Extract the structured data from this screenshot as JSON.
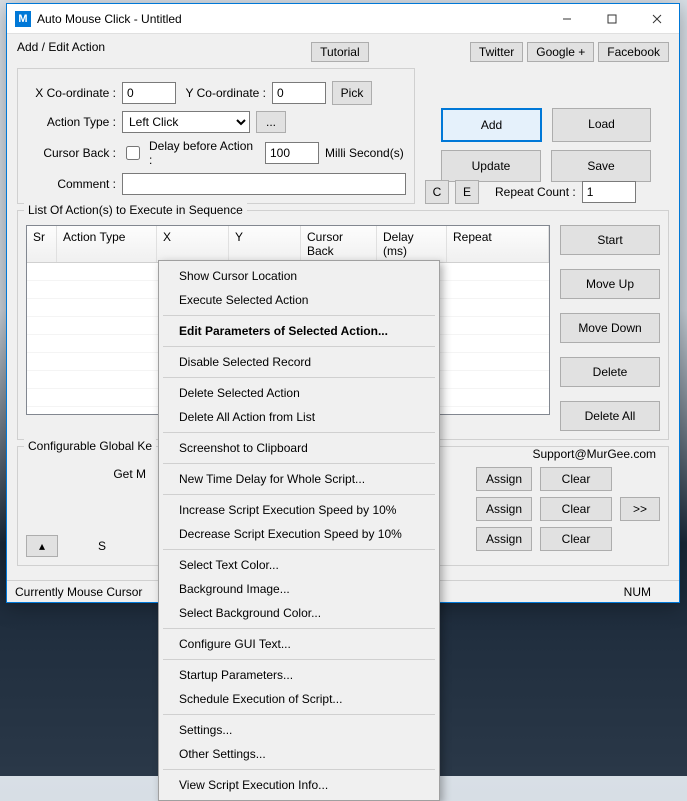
{
  "titlebar": {
    "app_icon_letter": "M",
    "title": "Auto Mouse Click - Untitled"
  },
  "top_buttons": {
    "tutorial": "Tutorial",
    "twitter": "Twitter",
    "google": "Google +",
    "facebook": "Facebook"
  },
  "add_edit": {
    "legend": "Add / Edit Action",
    "x_label": "X Co-ordinate :",
    "x_value": "0",
    "y_label": "Y Co-ordinate :",
    "y_value": "0",
    "pick": "Pick",
    "action_type_label": "Action Type :",
    "action_type_value": "Left Click",
    "dots": "...",
    "cursor_back_label": "Cursor Back :",
    "delay_label": "Delay before Action :",
    "delay_value": "100",
    "delay_units": "Milli Second(s)",
    "comment_label": "Comment :",
    "comment_value": "",
    "c_btn": "C",
    "e_btn": "E"
  },
  "main_buttons": {
    "add": "Add",
    "load": "Load",
    "update": "Update",
    "save": "Save"
  },
  "repeat": {
    "label": "Repeat Count :",
    "value": "1"
  },
  "list": {
    "legend": "List Of Action(s) to Execute in Sequence",
    "headers": {
      "sr": "Sr",
      "action_type": "Action Type",
      "x": "X",
      "y": "Y",
      "cursor_back": "Cursor Back",
      "delay": "Delay (ms)",
      "repeat": "Repeat"
    }
  },
  "side": {
    "start": "Start",
    "moveup": "Move Up",
    "movedown": "Move Down",
    "delete": "Delete",
    "deleteall": "Delete All"
  },
  "config": {
    "legend_partial": "Configurable Global Ke",
    "get_m_partial": "Get M",
    "s_partial": "S",
    "support": "Support@MurGee.com",
    "assign": "Assign",
    "clear": "Clear",
    "more": ">>",
    "updown_glyph": "▴"
  },
  "statusbar": {
    "left": "Currently Mouse Cursor",
    "right": "NUM"
  },
  "context_menu": {
    "items": [
      {
        "label": "Show Cursor Location"
      },
      {
        "label": "Execute Selected Action"
      },
      {
        "sep": true
      },
      {
        "label": "Edit Parameters of Selected Action...",
        "bold": true
      },
      {
        "sep": true
      },
      {
        "label": "Disable Selected Record"
      },
      {
        "sep": true
      },
      {
        "label": "Delete Selected Action"
      },
      {
        "label": "Delete All Action from List"
      },
      {
        "sep": true
      },
      {
        "label": "Screenshot to Clipboard"
      },
      {
        "sep": true
      },
      {
        "label": "New Time Delay for Whole Script..."
      },
      {
        "sep": true
      },
      {
        "label": "Increase Script Execution Speed by 10%"
      },
      {
        "label": "Decrease Script Execution Speed by 10%"
      },
      {
        "sep": true
      },
      {
        "label": "Select Text Color..."
      },
      {
        "label": "Background Image..."
      },
      {
        "label": "Select Background Color..."
      },
      {
        "sep": true
      },
      {
        "label": "Configure GUI Text..."
      },
      {
        "sep": true
      },
      {
        "label": "Startup Parameters..."
      },
      {
        "label": "Schedule Execution of Script..."
      },
      {
        "sep": true
      },
      {
        "label": "Settings..."
      },
      {
        "label": "Other Settings..."
      },
      {
        "sep": true
      },
      {
        "label": "View Script Execution Info..."
      }
    ]
  }
}
